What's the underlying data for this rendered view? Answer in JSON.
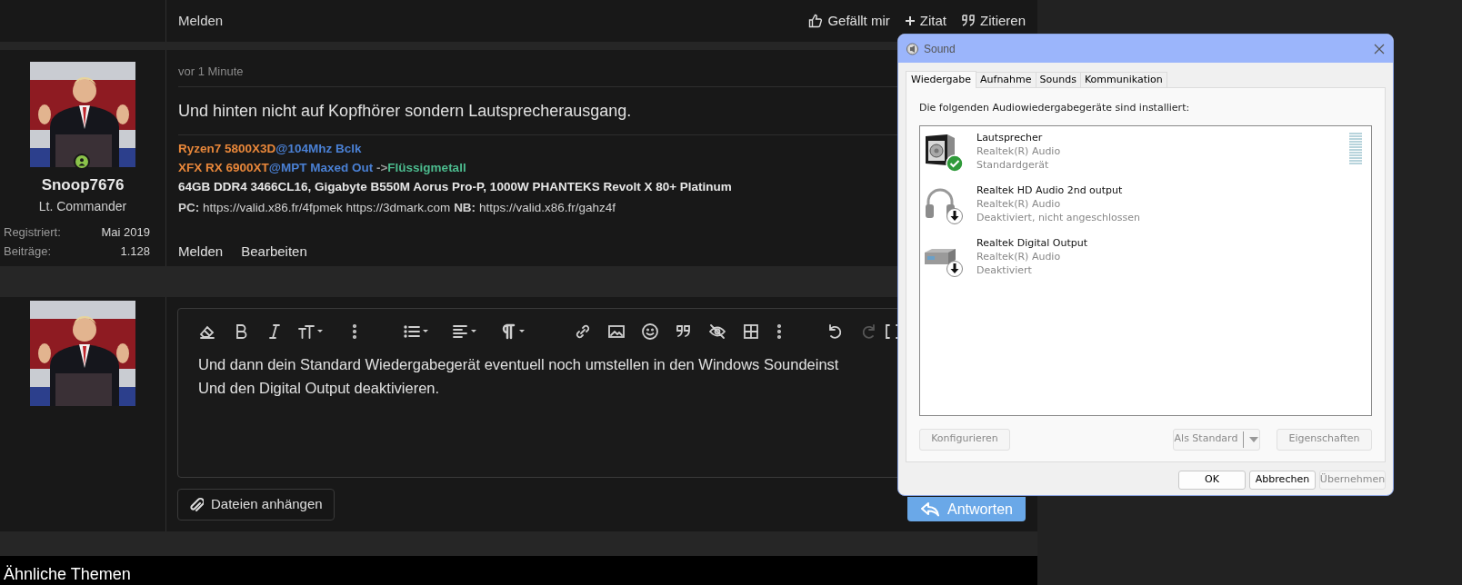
{
  "top_actions": {
    "left": "Melden",
    "right": [
      {
        "kind": "like",
        "label": "Gefällt mir"
      },
      {
        "kind": "plus",
        "label": "Zitat"
      },
      {
        "kind": "quote",
        "label": "Zitieren"
      }
    ]
  },
  "post": {
    "user": {
      "name": "Snoop7676",
      "rank": "Lt. Commander",
      "online": true,
      "stats": [
        {
          "label": "Registriert:",
          "value": "Mai 2019"
        },
        {
          "label": "Beiträge:",
          "value": "1.128"
        }
      ]
    },
    "time": "vor 1 Minute",
    "message": "Und hinten nicht auf Kopfhörer sondern Lautsprecherausgang.",
    "signature": [
      [
        {
          "text": "Ryzen7 5800X3D",
          "color": "#e8873a"
        },
        {
          "text": "@104Mhz Bclk",
          "color": "#4a80d4"
        }
      ],
      [
        {
          "text": "XFX RX 6900XT",
          "color": "#e8873a"
        },
        {
          "text": "@MPT Maxed Out",
          "color": "#4a80d4"
        },
        {
          "text": " ->",
          "color": "#9a9a9a"
        },
        {
          "text": "Flüssigmetall",
          "color": "#4cbb8e"
        }
      ],
      [
        {
          "text": "64GB DDR4 3466CL16, Gigabyte B550M Aorus Pro-P, 1000W PHANTEKS Revolt X 80+ Platinum",
          "color": "#e6e6e6"
        }
      ]
    ],
    "signature_links": "**PC:** https://valid.x86.fr/4fpmek https://3dmark.com **NB:** https://valid.x86.fr/gahz4f",
    "actions": [
      "Melden",
      "Bearbeiten"
    ]
  },
  "reply": {
    "text_lines": [
      "Und dann dein Standard Wiedergabegerät eventuell noch umstellen in den Windows Soundeinst",
      "Und den Digital Output deaktivieren."
    ],
    "attach_button": "Dateien anhängen",
    "submit_button": "Antworten"
  },
  "similar_heading": "Ähnliche Themen",
  "dialog": {
    "title": "Sound",
    "tabs": [
      {
        "label": "Wiedergabe",
        "selected": true
      },
      {
        "label": "Aufnahme",
        "selected": false
      },
      {
        "label": "Sounds",
        "selected": false
      },
      {
        "label": "Kommunikation",
        "selected": false
      }
    ],
    "heading": "Die folgenden Audiowiedergabegeräte sind installiert:",
    "devices": [
      {
        "kind": "speaker",
        "name": "Lautsprecher",
        "driver": "Realtek(R) Audio",
        "status": "Standardgerät",
        "default": true,
        "level": 0
      },
      {
        "kind": "headphones",
        "name": "Realtek HD Audio 2nd output",
        "driver": "Realtek(R) Audio",
        "status": "Deaktiviert, nicht angeschlossen",
        "default": false
      },
      {
        "kind": "digital",
        "name": "Realtek Digital Output",
        "driver": "Realtek(R) Audio",
        "status": "Deaktiviert",
        "default": false
      }
    ],
    "buttons": [
      {
        "label": "Konfigurieren",
        "disabled": true
      },
      {
        "label": "Als Standard",
        "disabled": true
      },
      {
        "label": "Eigenschaften",
        "disabled": true
      }
    ],
    "footer_buttons": [
      {
        "label": "OK",
        "disabled": false
      },
      {
        "label": "Abbrechen",
        "disabled": false
      },
      {
        "label": "Übernehmen",
        "disabled": true
      }
    ]
  }
}
